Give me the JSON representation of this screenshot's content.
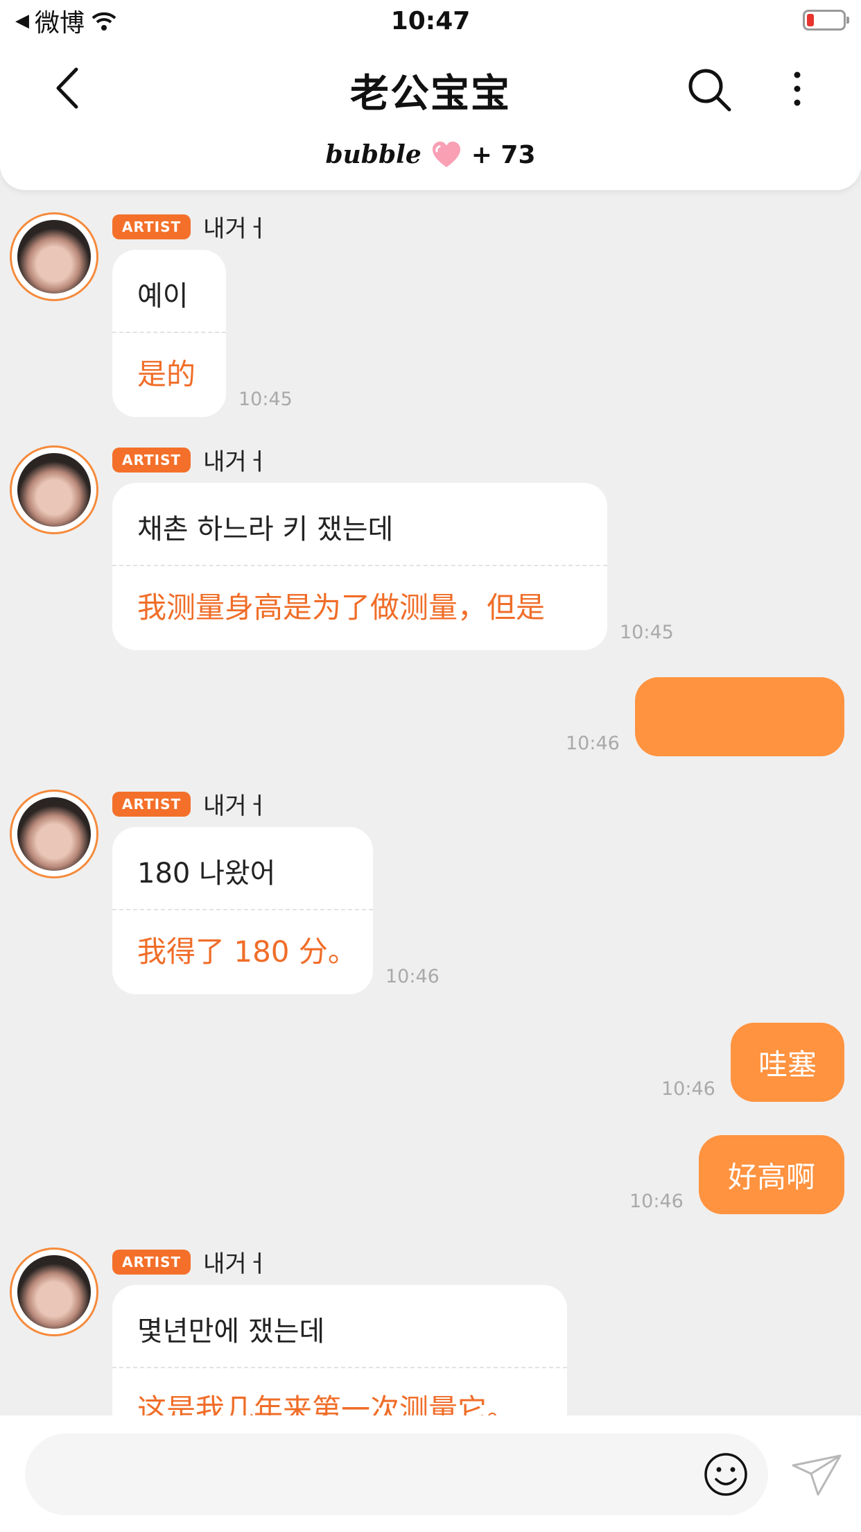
{
  "status_bar": {
    "back_app": "微博",
    "time": "10:47"
  },
  "header": {
    "title": "老公宝宝",
    "brand": "bubble",
    "plus_count": "+ 73"
  },
  "icons": {
    "back": "chevron-left-icon",
    "search": "search-icon",
    "more": "more-vertical-icon",
    "wifi": "wifi-icon",
    "heart": "heart-icon",
    "emoji": "smile-icon",
    "send": "paper-plane-icon"
  },
  "colors": {
    "accent": "#f4702a",
    "outgoing_bubble": "#ff9340",
    "translation_text": "#f06d28"
  },
  "messages": [
    {
      "badge": "ARTIST",
      "sender": "내거ㅓ",
      "text": "예이",
      "translation": "是的",
      "time": "10:45"
    },
    {
      "badge": "ARTIST",
      "sender": "내거ㅓ",
      "text": "채촌 하느라 키 쟀는데",
      "translation": "我测量身高是为了做测量，但是",
      "time": "10:45"
    },
    {
      "text": "",
      "time": "10:46"
    },
    {
      "badge": "ARTIST",
      "sender": "내거ㅓ",
      "text": "180 나왔어",
      "translation": "我得了 180 分。",
      "time": "10:46"
    },
    {
      "text": "哇塞",
      "time": "10:46"
    },
    {
      "text": "好高啊",
      "time": "10:46"
    },
    {
      "badge": "ARTIST",
      "sender": "내거ㅓ",
      "text": "몇년만에 쟀는데",
      "translation": "这是我几年来第一次测量它。"
    }
  ],
  "composer": {
    "placeholder": ""
  }
}
